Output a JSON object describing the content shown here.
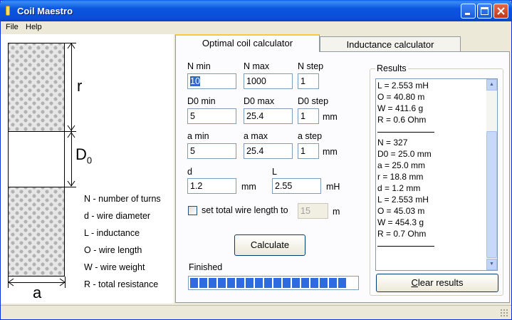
{
  "window": {
    "title": "Coil Maestro"
  },
  "menu": {
    "file": "File",
    "help": "Help"
  },
  "diagram": {
    "r_label": "r",
    "d0_label": "D",
    "d0_sub": "0",
    "a_label": "a",
    "legend": [
      "N - number of turns",
      "d - wire diameter",
      "L - inductance",
      "O - wire length",
      "W - wire weight",
      "R - total resistance"
    ]
  },
  "tabs": {
    "optimal": "Optimal coil calculator",
    "inductance": "Inductance calculator"
  },
  "form": {
    "n_min_label": "N min",
    "n_min": "10",
    "n_max_label": "N max",
    "n_max": "1000",
    "n_step_label": "N step",
    "n_step": "1",
    "d0_min_label": "D0 min",
    "d0_min": "5",
    "d0_max_label": "D0 max",
    "d0_max": "25.4",
    "d0_step_label": "D0 step",
    "d0_step": "1",
    "d0_unit": "mm",
    "a_min_label": "a min",
    "a_min": "5",
    "a_max_label": "a max",
    "a_max": "25.4",
    "a_step_label": "a step",
    "a_step": "1",
    "a_unit": "mm",
    "d_label": "d",
    "d": "1.2",
    "d_unit": "mm",
    "l_label": "L",
    "l": "2.55",
    "l_unit": "mH",
    "wire_length_checkbox": "set total wire length to",
    "wire_length": "15",
    "wire_length_unit": "m",
    "calculate": "Calculate",
    "status": "Finished",
    "progress": 1.0,
    "progress_segments": 17
  },
  "results": {
    "title": "Results",
    "block1": [
      "L = 2.553 mH",
      "O = 40.80 m",
      "W = 411.6 g",
      "R = 0.6 Ohm"
    ],
    "block2": [
      "N = 327",
      "D0 = 25.0 mm",
      "a = 25.0 mm",
      "r = 18.8 mm",
      "d = 1.2 mm",
      "L = 2.553 mH",
      "O = 45.03 m",
      "W = 454.3 g",
      "R = 0.7 Ohm"
    ],
    "clear": "Clear results"
  },
  "colors": {
    "titlebar": "#0a55df",
    "progress": "#2f6be0",
    "tab_highlight": "#ffc83c"
  }
}
